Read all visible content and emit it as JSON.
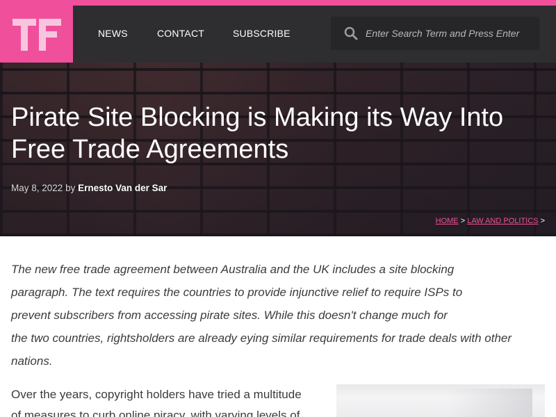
{
  "colors": {
    "accent": "#f0509b",
    "header_bg": "#2e2e30",
    "search_bg": "#262628",
    "text": "#3b3b3f"
  },
  "header": {
    "logo_text": "TF",
    "nav": [
      {
        "label": "NEWS"
      },
      {
        "label": "CONTACT"
      },
      {
        "label": "SUBSCRIBE"
      }
    ],
    "search": {
      "placeholder": "Enter Search Term and Press Enter",
      "icon": "search-icon"
    }
  },
  "article": {
    "title": "Pirate Site Blocking is Making its Way Into Free Trade Agreements",
    "date": "May 8, 2022",
    "by": "by",
    "author": "Ernesto Van der Sar",
    "breadcrumb": {
      "home": "Home",
      "separator": ">",
      "category": "Law and Politics"
    },
    "lead_lines": [
      "The new free trade agreement between Australia and the UK includes a site blocking",
      "paragraph. The text requires the countries to provide injunctive relief to require ISPs to",
      "prevent subscribers from accessing pirate sites. While this doesn't change much for",
      "the two countries, rightsholders are already eying similar requirements for trade deals with other",
      "nations."
    ],
    "body_lines": [
      "Over the years, copyright holders have tried a multitude",
      "of measures to curb online piracy, with varying levels of"
    ]
  }
}
